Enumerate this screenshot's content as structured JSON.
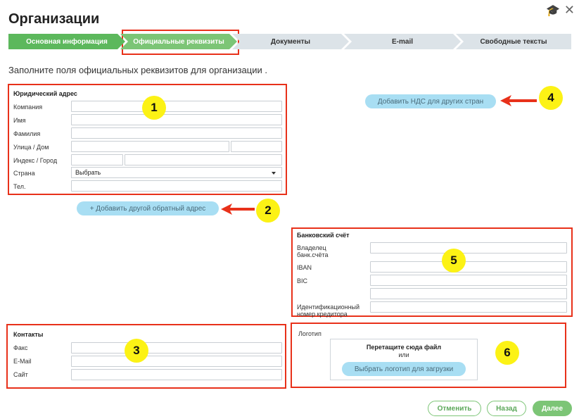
{
  "window": {
    "title": "Организации",
    "icons": {
      "help": "graduation-cap-icon",
      "close": "close-icon"
    }
  },
  "steps": [
    {
      "label": "Основная информация",
      "state": "done"
    },
    {
      "label": "Официальные реквизиты",
      "state": "active"
    },
    {
      "label": "Документы",
      "state": "todo"
    },
    {
      "label": "E-mail",
      "state": "todo"
    },
    {
      "label": "Свободные тексты",
      "state": "todo"
    }
  ],
  "intro": "Заполните поля официальных реквизитов для организации .",
  "legal_address": {
    "title": "Юридический адрес",
    "company_label": "Компания",
    "first_name_label": "Имя",
    "last_name_label": "Фамилия",
    "street_label": "Улица / Дом",
    "zip_city_label": "Индекс / Город",
    "country_label": "Страна",
    "country_value": "Выбрать",
    "phone_label": "Тел."
  },
  "add_address_button": "+ Добавить другой обратный адрес",
  "add_vat_button": "Добавить НДС для других стран",
  "bank": {
    "title": "Банковский счёт",
    "owner_label_1": "Владелец",
    "owner_label_2": "банк.счёта",
    "iban_label": "IBAN",
    "bic_label": "BIC",
    "creditor_label_1": "Идентификационный",
    "creditor_label_2": "номер кредитора"
  },
  "contacts": {
    "title": "Контакты",
    "fax_label": "Факс",
    "email_label": "E-Mail",
    "site_label": "Сайт"
  },
  "logo": {
    "title": "Логотип",
    "drop_text": "Перетащите сюда файл",
    "or_text": "или",
    "choose_button": "Выбрать логотип для загрузки"
  },
  "badges": [
    "1",
    "2",
    "3",
    "4",
    "5",
    "6"
  ],
  "footer": {
    "cancel": "Отменить",
    "back": "Назад",
    "next": "Далее"
  },
  "colors": {
    "accent_green": "#7cc576",
    "annotation_red": "#e8311a",
    "badge_yellow": "#fcf215",
    "pill_blue": "#a8def3"
  }
}
